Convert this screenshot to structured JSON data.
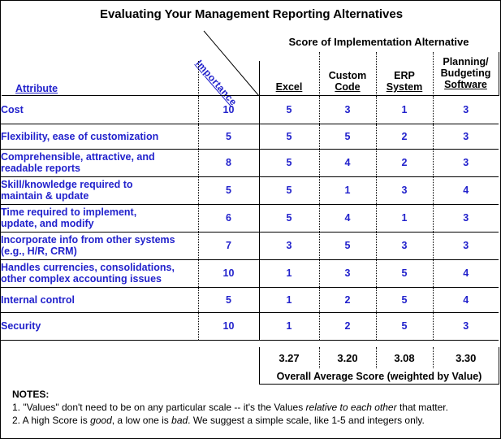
{
  "title": "Evaluating Your Management Reporting Alternatives",
  "score_group_header": "Score of Implementation Alternative",
  "importance_label": "Importance",
  "attribute_header": "Attribute",
  "columns": [
    {
      "line1": "Excel",
      "line2": ""
    },
    {
      "line1": "Custom",
      "line2": "Code"
    },
    {
      "line1": "ERP",
      "line2": "System"
    },
    {
      "line1": "Planning/",
      "line2": "Budgeting",
      "line3": "Software"
    }
  ],
  "rows": [
    {
      "attribute": "Cost",
      "attribute_line2": "",
      "importance": "10",
      "scores": [
        "5",
        "3",
        "1",
        "3"
      ]
    },
    {
      "attribute": "Flexibility, ease of customization",
      "attribute_line2": "",
      "importance": "5",
      "scores": [
        "5",
        "5",
        "2",
        "3"
      ]
    },
    {
      "attribute": "Comprehensible, attractive, and",
      "attribute_line2": "readable reports",
      "importance": "8",
      "scores": [
        "5",
        "4",
        "2",
        "3"
      ]
    },
    {
      "attribute": "Skill/knowledge required to",
      "attribute_line2": "maintain & update",
      "importance": "5",
      "scores": [
        "5",
        "1",
        "3",
        "4"
      ]
    },
    {
      "attribute": "Time required to implement,",
      "attribute_line2": "update, and modify",
      "importance": "6",
      "scores": [
        "5",
        "4",
        "1",
        "3"
      ]
    },
    {
      "attribute": "Incorporate info from other systems",
      "attribute_line2": "(e.g., H/R, CRM)",
      "importance": "7",
      "scores": [
        "3",
        "5",
        "3",
        "3"
      ]
    },
    {
      "attribute": "Handles currencies, consolidations,",
      "attribute_line2": "other complex accounting issues",
      "importance": "10",
      "scores": [
        "1",
        "3",
        "5",
        "4"
      ]
    },
    {
      "attribute": "Internal control",
      "attribute_line2": "",
      "importance": "5",
      "scores": [
        "1",
        "2",
        "5",
        "4"
      ]
    },
    {
      "attribute": "Security",
      "attribute_line2": "",
      "importance": "10",
      "scores": [
        "1",
        "2",
        "5",
        "3"
      ]
    }
  ],
  "totals": [
    "3.27",
    "3.20",
    "3.08",
    "3.30"
  ],
  "average_caption": "Overall Average Score (weighted by Value)",
  "notes": {
    "heading": "NOTES:",
    "note1_a": "1. \"Values\" don't need to be on any particular scale -- it's the Values ",
    "note1_italic": "relative to each other",
    "note1_b": " that matter.",
    "note2_a": "2.  A high Score is ",
    "note2_italic1": "good",
    "note2_b": ", a low one is ",
    "note2_italic2": "bad",
    "note2_c": ".  We suggest a simple scale, like 1-5 and integers only."
  },
  "colors": {
    "text_blue": "#2222CC",
    "text_black": "#000000",
    "background": "#FFFFFF"
  }
}
